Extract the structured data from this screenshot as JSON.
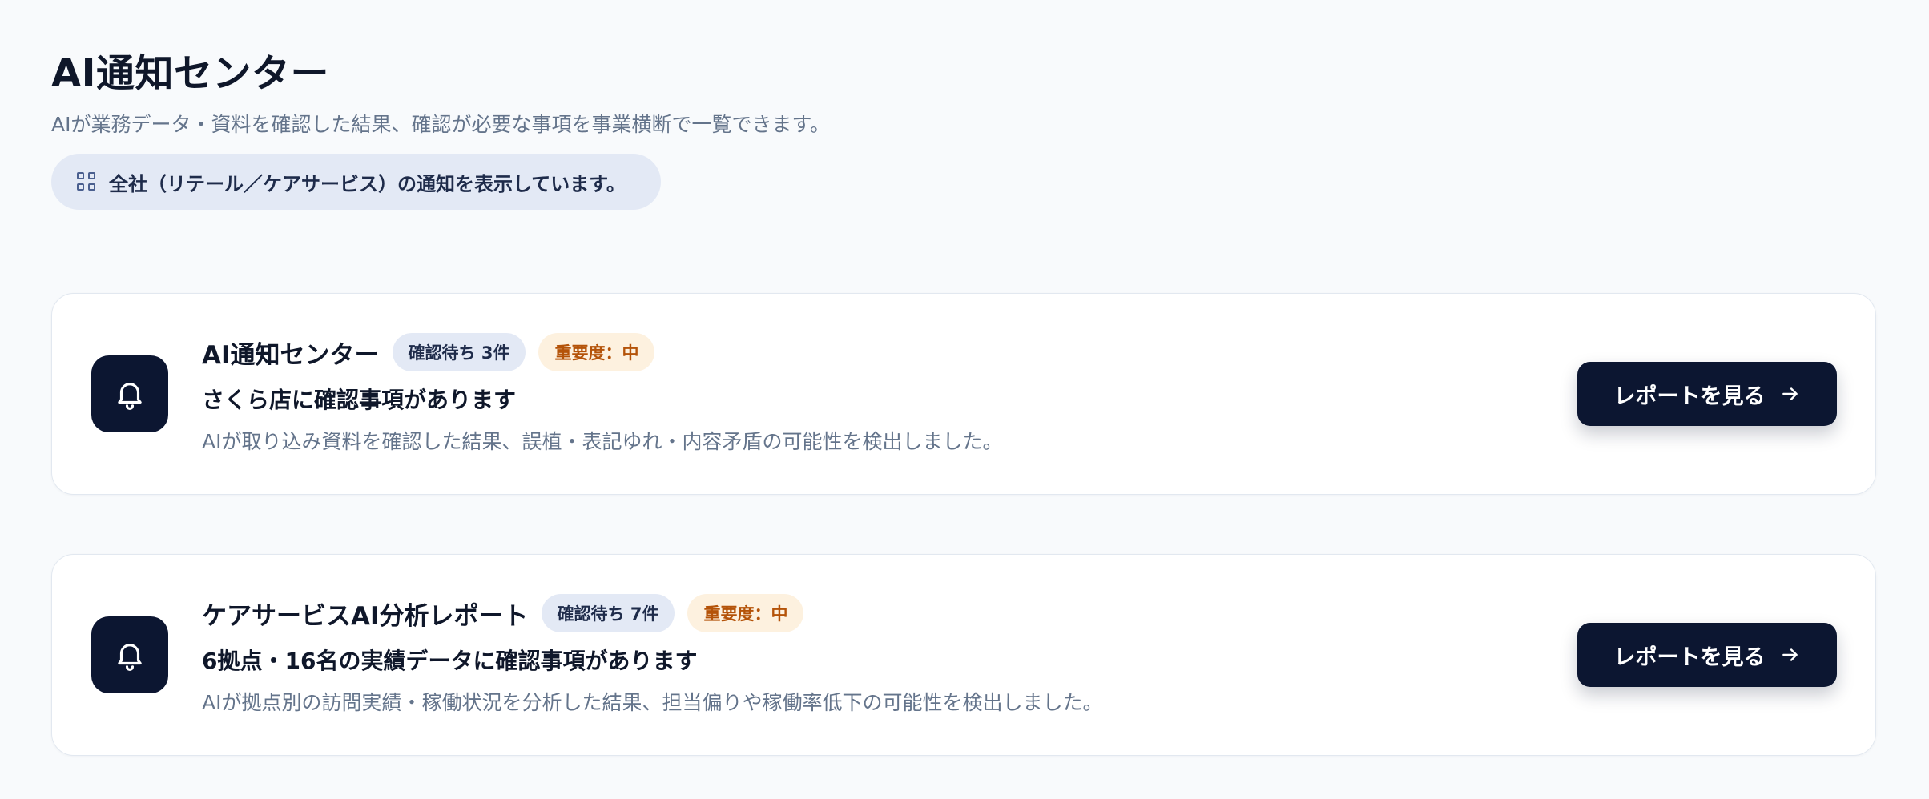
{
  "header": {
    "title": "AI通知センター",
    "subtitle": "AIが業務データ・資料を確認した結果、確認が必要な事項を事業横断で一覧できます。",
    "scope_text": "全社（リテール／ケアサービス）の通知を表示しています。",
    "scope_icon": "grid-icon"
  },
  "colors": {
    "background": "#f8fafc",
    "navy": "#0c1631",
    "pill": "#e3e9f5",
    "severity_bg": "#fdf1df",
    "severity_text": "#b45309",
    "muted_text": "#64748b"
  },
  "cards": [
    {
      "icon": "bell-icon",
      "title": "AI通知センター",
      "count_badge": "確認待ち 3件",
      "severity_badge": "重要度：中",
      "headline": "さくら店に確認事項があります",
      "description": "AIが取り込み資料を確認した結果、誤植・表記ゆれ・内容矛盾の可能性を検出しました。",
      "button_label": "レポートを見る",
      "button_icon": "arrow-right-icon"
    },
    {
      "icon": "bell-icon",
      "title": "ケアサービスAI分析レポート",
      "count_badge": "確認待ち 7件",
      "severity_badge": "重要度：中",
      "headline": "6拠点・16名の実績データに確認事項があります",
      "description": "AIが拠点別の訪問実績・稼働状況を分析した結果、担当偏りや稼働率低下の可能性を検出しました。",
      "button_label": "レポートを見る",
      "button_icon": "arrow-right-icon"
    }
  ]
}
